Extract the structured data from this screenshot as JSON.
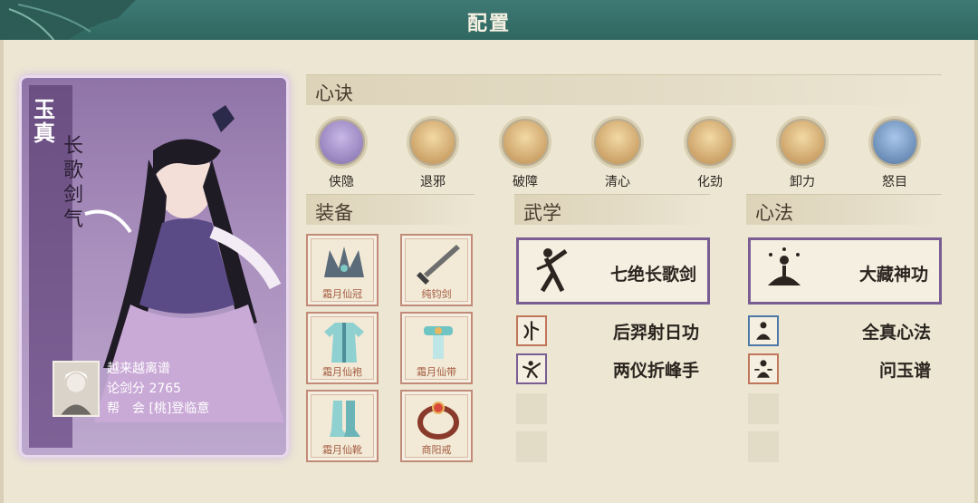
{
  "header": {
    "title": "配置"
  },
  "character": {
    "name": "玉真",
    "title": "长歌剑气",
    "player": {
      "name": "越来越离谱",
      "score_label": "论剑分",
      "score": "2765",
      "guild_label": "帮　会",
      "guild": "[桃]登临意"
    }
  },
  "sections": {
    "xinjue": "心诀",
    "equipment": "装备",
    "wuxue": "武学",
    "xinfa": "心法"
  },
  "skills": [
    {
      "label": "侠隐",
      "color": "#7c68a8",
      "icon": "cloud-icon"
    },
    {
      "label": "退邪",
      "color": "#b8874a",
      "icon": "pillar-icon"
    },
    {
      "label": "破障",
      "color": "#b8874a",
      "icon": "fist-icon"
    },
    {
      "label": "清心",
      "color": "#b8874a",
      "icon": "lotus-icon"
    },
    {
      "label": "化劲",
      "color": "#b8874a",
      "icon": "slash-icon"
    },
    {
      "label": "卸力",
      "color": "#b8874a",
      "icon": "swirl-icon"
    },
    {
      "label": "怒目",
      "color": "#4a6f9c",
      "icon": "eye-icon"
    }
  ],
  "equipment": [
    {
      "label": "霜月仙冠",
      "icon": "crown-icon"
    },
    {
      "label": "纯钧剑",
      "icon": "sword-icon"
    },
    {
      "label": "霜月仙袍",
      "icon": "robe-icon"
    },
    {
      "label": "霜月仙带",
      "icon": "belt-icon"
    },
    {
      "label": "霜月仙靴",
      "icon": "boots-icon"
    },
    {
      "label": "商阳戒",
      "icon": "ring-icon"
    }
  ],
  "wuxue": {
    "main": {
      "name": "七绝长歌剑",
      "icon": "swordsman-icon"
    },
    "secondary": [
      {
        "name": "后羿射日功",
        "icon": "archer-icon"
      },
      {
        "name": "两仪折峰手",
        "icon": "fighter-icon"
      }
    ]
  },
  "xinfa": {
    "main": {
      "name": "大藏神功",
      "icon": "meditation-icon"
    },
    "secondary": [
      {
        "name": "全真心法",
        "icon": "sage-icon"
      },
      {
        "name": "问玉谱",
        "icon": "monk-icon"
      }
    ]
  }
}
